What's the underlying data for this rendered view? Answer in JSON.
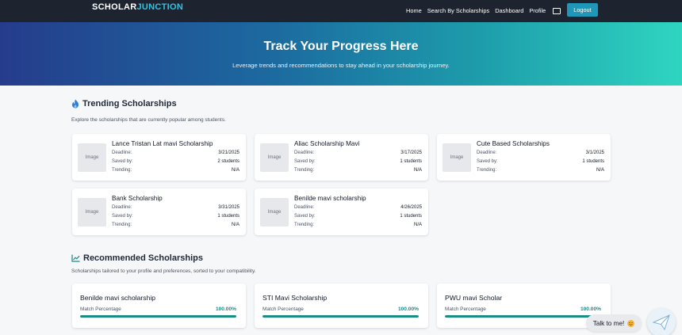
{
  "navbar": {
    "brand_part1": "SCHOLAR",
    "brand_part2": "JUNCTION",
    "links": [
      "Home",
      "Search By Scholarships",
      "Dashboard",
      "Profile"
    ],
    "window_icon": "window-icon",
    "logout_label": "Logout"
  },
  "hero": {
    "title": "Track Your Progress Here",
    "subtitle": "Leverage trends and recommendations to stay ahead in your scholarship journey."
  },
  "trending": {
    "icon": "fire-icon",
    "title": "Trending Scholarships",
    "description": "Explore the scholarships that are currently popular among students.",
    "labels": {
      "deadline": "Deadline:",
      "saved": "Saved by:",
      "trending": "Trending:",
      "image": "Image"
    },
    "cards": [
      {
        "name": "Lance Tristan Lat mavi Scholarship",
        "deadline": "3/21/2025",
        "saved": "2 students",
        "trending": "N/A"
      },
      {
        "name": "Aliac Scholarship Mavi",
        "deadline": "3/17/2025",
        "saved": "1 students",
        "trending": "N/A"
      },
      {
        "name": "Cute Based Scholarships",
        "deadline": "3/1/2025",
        "saved": "1 students",
        "trending": "N/A"
      },
      {
        "name": "Bank Scholarship",
        "deadline": "3/31/2025",
        "saved": "1 students",
        "trending": "N/A"
      },
      {
        "name": "Benilde mavi scholarship",
        "deadline": "4/26/2025",
        "saved": "1 students",
        "trending": "N/A"
      }
    ]
  },
  "recommended": {
    "icon": "chart-line-icon",
    "title": "Recommended Scholarships",
    "description": "Scholarships tailored to your profile and preferences, sorted to your compatibility.",
    "match_label": "Match Percentage",
    "cards": [
      {
        "name": "Benilde mavi scholarship",
        "match": "100.00%",
        "match_value": 1.0
      },
      {
        "name": "STI Mavi Scholarship",
        "match": "100.00%",
        "match_value": 1.0
      },
      {
        "name": "PWU mavi Scholar",
        "match": "100.00%",
        "match_value": 1.0
      }
    ]
  },
  "chat": {
    "label": "Talk to me!",
    "emoji_icon": "smile-emoji-icon",
    "button_icon": "paper-plane-icon"
  },
  "colors": {
    "navbar_bg": "#1d2430",
    "brand_accent": "#2fc4e3",
    "logout_bg": "#1f97b8",
    "hero_gradient_start": "#253c8c",
    "hero_gradient_end": "#2fd5c1",
    "match_accent": "#1a8c86",
    "fire_icon": "#2f7fd9"
  }
}
